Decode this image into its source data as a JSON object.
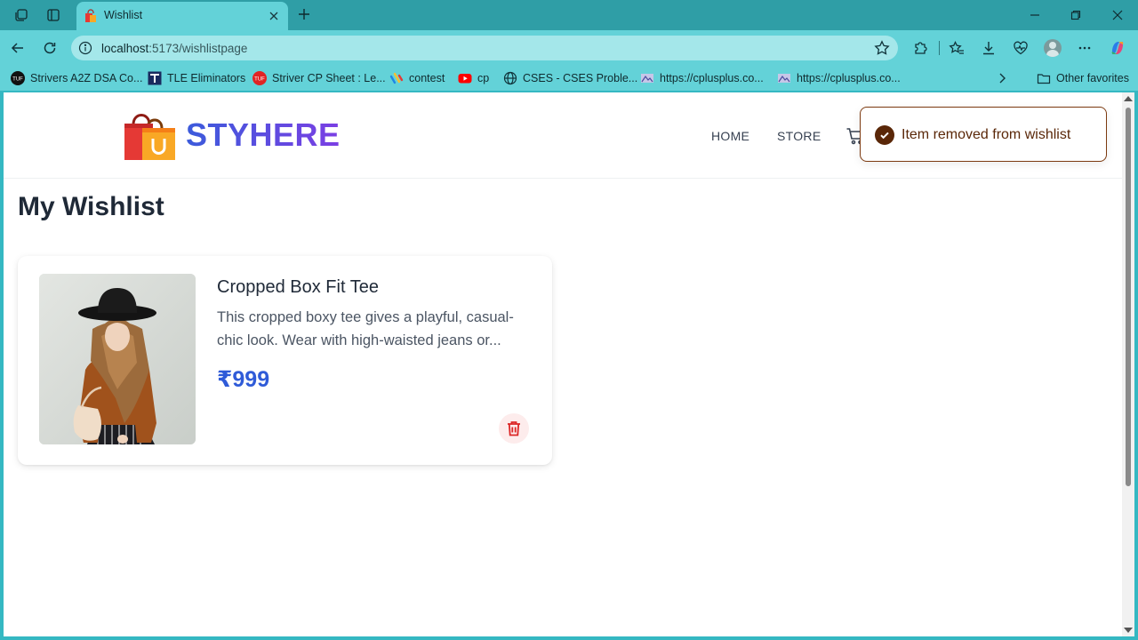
{
  "browser": {
    "tab": {
      "title": "Wishlist"
    },
    "address": {
      "host": "localhost",
      "path": ":5173/wishlistpage"
    },
    "bookmarks": [
      {
        "label": "Strivers A2Z DSA Co...",
        "icon": "tuf-icon"
      },
      {
        "label": "TLE Eliminators",
        "icon": "tle-icon"
      },
      {
        "label": "Striver CP Sheet : Le...",
        "icon": "tuf-red-icon"
      },
      {
        "label": "contest",
        "icon": "codeforces-icon"
      },
      {
        "label": "cp",
        "icon": "youtube-icon"
      },
      {
        "label": "CSES - CSES Proble...",
        "icon": "globe-icon"
      },
      {
        "label": "https://cplusplus.co...",
        "icon": "cplusplus-icon"
      },
      {
        "label": "https://cplusplus.co...",
        "icon": "cplusplus-icon"
      }
    ],
    "other_favorites": "Other favorites"
  },
  "site": {
    "brand": "STYHERE",
    "nav": {
      "home": "HOME",
      "store": "STORE"
    }
  },
  "page": {
    "title": "My Wishlist",
    "items": [
      {
        "name": "Cropped Box Fit Tee",
        "description": "This cropped boxy tee gives a playful, casual-chic look. Wear with high-waisted jeans or...",
        "price": "₹999"
      }
    ]
  },
  "toast": {
    "message": "Item removed from wishlist"
  },
  "colors": {
    "chrome_dark": "#2f9ea6",
    "chrome_light": "#63d2d8",
    "brand_gradient_start": "#3b5bdb",
    "brand_gradient_end": "#7b3fe4",
    "price": "#2f5bd8",
    "delete": "#dc2626",
    "toast_accent": "#5a2708"
  }
}
